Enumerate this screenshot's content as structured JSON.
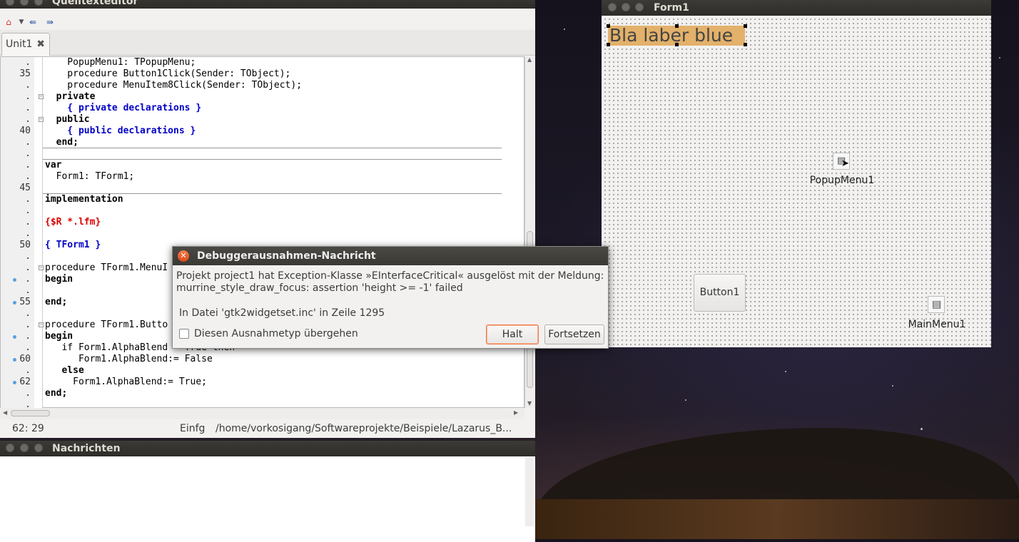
{
  "editor": {
    "title": "Quelltexteditor",
    "tab_label": "Unit1",
    "lines": [
      {
        "num": ".",
        "code": "    PopupMenu1: TPopupMenu;"
      },
      {
        "num": "35",
        "code": "    procedure Button1Click(Sender: TObject);"
      },
      {
        "num": ".",
        "code": "    procedure MenuItem8Click(Sender: TObject);"
      },
      {
        "num": ".",
        "code": "  private"
      },
      {
        "num": ".",
        "code": "    { private declarations }"
      },
      {
        "num": ".",
        "code": "  public"
      },
      {
        "num": "40",
        "code": "    { public declarations }"
      },
      {
        "num": ".",
        "code": "  end;"
      },
      {
        "num": ".",
        "code": ""
      },
      {
        "num": ".",
        "code": "var"
      },
      {
        "num": ".",
        "code": "  Form1: TForm1;"
      },
      {
        "num": "45",
        "code": ""
      },
      {
        "num": ".",
        "code": "implementation"
      },
      {
        "num": ".",
        "code": ""
      },
      {
        "num": ".",
        "code": "{$R *.lfm}"
      },
      {
        "num": ".",
        "code": ""
      },
      {
        "num": "50",
        "code": "{ TForm1 }"
      },
      {
        "num": ".",
        "code": ""
      },
      {
        "num": ".",
        "code": "procedure TForm1.MenuI"
      },
      {
        "num": ".",
        "code": "begin"
      },
      {
        "num": ".",
        "code": ""
      },
      {
        "num": "55",
        "code": "end;"
      },
      {
        "num": ".",
        "code": ""
      },
      {
        "num": ".",
        "code": "procedure TForm1.Butto"
      },
      {
        "num": ".",
        "code": "begin"
      },
      {
        "num": ".",
        "code": "   if Form1.AlphaBlend = True then"
      },
      {
        "num": "60",
        "code": "      Form1.AlphaBlend:= False"
      },
      {
        "num": ".",
        "code": "   else"
      },
      {
        "num": "62",
        "code": "     Form1.AlphaBlend:= True;"
      },
      {
        "num": ".",
        "code": "end;"
      },
      {
        "num": ".",
        "code": ""
      }
    ],
    "status_pos": "62: 29",
    "status_mode": "Einfg",
    "status_path": "/home/vorkosigang/Softwareprojekte/Beispiele/Lazarus_B..."
  },
  "messages": {
    "title": "Nachrichten"
  },
  "form": {
    "title": "Form1",
    "label_text": "Bla laber blue",
    "button_text": "Button1",
    "popup_name": "PopupMenu1",
    "mainmenu_name": "MainMenu1"
  },
  "dialog": {
    "title": "Debuggerausnahmen-Nachricht",
    "message_line1": "Projekt project1 hat Exception-Klasse »EInterfaceCritical« ausgelöst mit der Meldung:",
    "message_line2": "murrine_style_draw_focus: assertion 'height >= -1' failed",
    "file_line": "In Datei 'gtk2widgetset.inc' in Zeile 1295",
    "checkbox_label": "Diesen Ausnahmetyp übergehen",
    "halt_label": "Halt",
    "continue_label": "Fortsetzen"
  }
}
